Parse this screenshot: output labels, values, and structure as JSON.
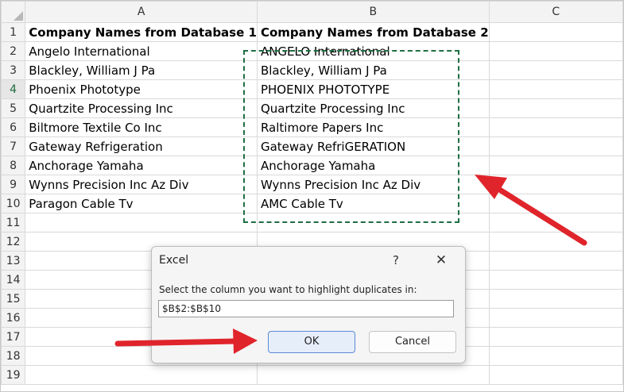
{
  "sheet": {
    "columns": [
      "A",
      "B",
      "C"
    ],
    "rows": [
      {
        "num": "1",
        "a": "Company Names from Database 1",
        "b": "Company Names from Database 2"
      },
      {
        "num": "2",
        "a": "Angelo International",
        "b": "ANGELO International"
      },
      {
        "num": "3",
        "a": "Blackley, William J Pa",
        "b": "Blackley, William J Pa"
      },
      {
        "num": "4",
        "a": "Phoenix Phototype",
        "b": "PHOENIX PHOTOTYPE"
      },
      {
        "num": "5",
        "a": "Quartzite Processing Inc",
        "b": "Quartzite Processing Inc"
      },
      {
        "num": "6",
        "a": "Biltmore Textile Co Inc",
        "b": "Raltimore Papers Inc"
      },
      {
        "num": "7",
        "a": "Gateway Refrigeration",
        "b": "Gateway RefriGERATION"
      },
      {
        "num": "8",
        "a": "Anchorage Yamaha",
        "b": "Anchorage Yamaha"
      },
      {
        "num": "9",
        "a": "Wynns Precision Inc Az Div",
        "b": "Wynns Precision Inc Az Div"
      },
      {
        "num": "10",
        "a": "Paragon Cable Tv",
        "b": "AMC Cable Tv"
      },
      {
        "num": "11",
        "a": "",
        "b": ""
      },
      {
        "num": "12",
        "a": "",
        "b": ""
      },
      {
        "num": "13",
        "a": "",
        "b": ""
      },
      {
        "num": "14",
        "a": "",
        "b": ""
      },
      {
        "num": "15",
        "a": "",
        "b": ""
      },
      {
        "num": "16",
        "a": "",
        "b": ""
      },
      {
        "num": "17",
        "a": "",
        "b": ""
      },
      {
        "num": "18",
        "a": "",
        "b": ""
      },
      {
        "num": "19",
        "a": "",
        "b": ""
      }
    ]
  },
  "dialog": {
    "title": "Excel",
    "help": "?",
    "close": "✕",
    "prompt": "Select the column you want to highlight duplicates in:",
    "input_value": "$B$2:$B$10",
    "ok_label": "OK",
    "cancel_label": "Cancel"
  },
  "colors": {
    "selection_border": "#1e6f43",
    "arrow": "#e0242b",
    "ok_button_border": "#5b8ad6"
  }
}
